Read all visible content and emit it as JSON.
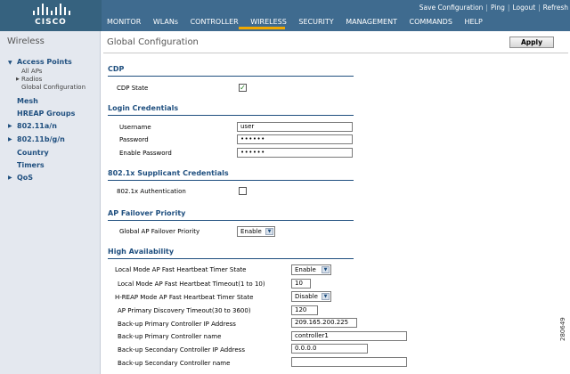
{
  "header": {
    "logo_text": "CISCO",
    "top_links": [
      "Save Configuration",
      "Ping",
      "Logout",
      "Refresh"
    ],
    "nav": [
      "MONITOR",
      "WLANs",
      "CONTROLLER",
      "WIRELESS",
      "SECURITY",
      "MANAGEMENT",
      "COMMANDS",
      "HELP"
    ],
    "active_nav": "WIRELESS",
    "colors": {
      "bar": "#3f6b8f",
      "active_underline": "#f0a800"
    }
  },
  "sidebar": {
    "title": "Wireless",
    "access_points": "Access Points",
    "all_aps": "All APs",
    "radios": "Radios",
    "global_config": "Global Configuration",
    "mesh": "Mesh",
    "hreap_groups": "HREAP Groups",
    "dot11an": "802.11a/n",
    "dot11bgn": "802.11b/g/n",
    "country": "Country",
    "timers": "Timers",
    "qos": "QoS"
  },
  "main": {
    "title": "Global Configuration",
    "apply": "Apply",
    "cdp": {
      "heading": "CDP",
      "state_label": "CDP State",
      "state_checked": true
    },
    "login": {
      "heading": "Login Credentials",
      "username_label": "Username",
      "username": "user",
      "password_label": "Password",
      "password": "••••••",
      "enable_label": "Enable Password",
      "enable_password": "••••••"
    },
    "dot1x": {
      "heading": "802.1x Supplicant Credentials",
      "auth_label": "802.1x Authentication",
      "auth_checked": false
    },
    "failover": {
      "heading": "AP Failover Priority",
      "label": "Global AP Failover Priority",
      "value": "Enable"
    },
    "ha": {
      "heading": "High Availability",
      "local_timer_state_label": "Local Mode AP Fast Heartbeat Timer State",
      "local_timer_state": "Enable",
      "local_timeout_label": "Local Mode AP Fast Heartbeat Timeout(1 to 10)",
      "local_timeout": "10",
      "hreap_timer_state_label": "H-REAP Mode AP Fast Heartbeat Timer State",
      "hreap_timer_state": "Disable",
      "discovery_timeout_label": "AP Primary Discovery Timeout(30 to 3600)",
      "discovery_timeout": "120",
      "primary_ip_label": "Back-up Primary Controller IP Address",
      "primary_ip": "209.165.200.225",
      "primary_name_label": "Back-up Primary Controller name",
      "primary_name": "controller1",
      "secondary_ip_label": "Back-up Secondary Controller IP Address",
      "secondary_ip": "0.0.0.0",
      "secondary_name_label": "Back-up Secondary Controller name",
      "secondary_name": ""
    }
  },
  "watermark": "280649"
}
